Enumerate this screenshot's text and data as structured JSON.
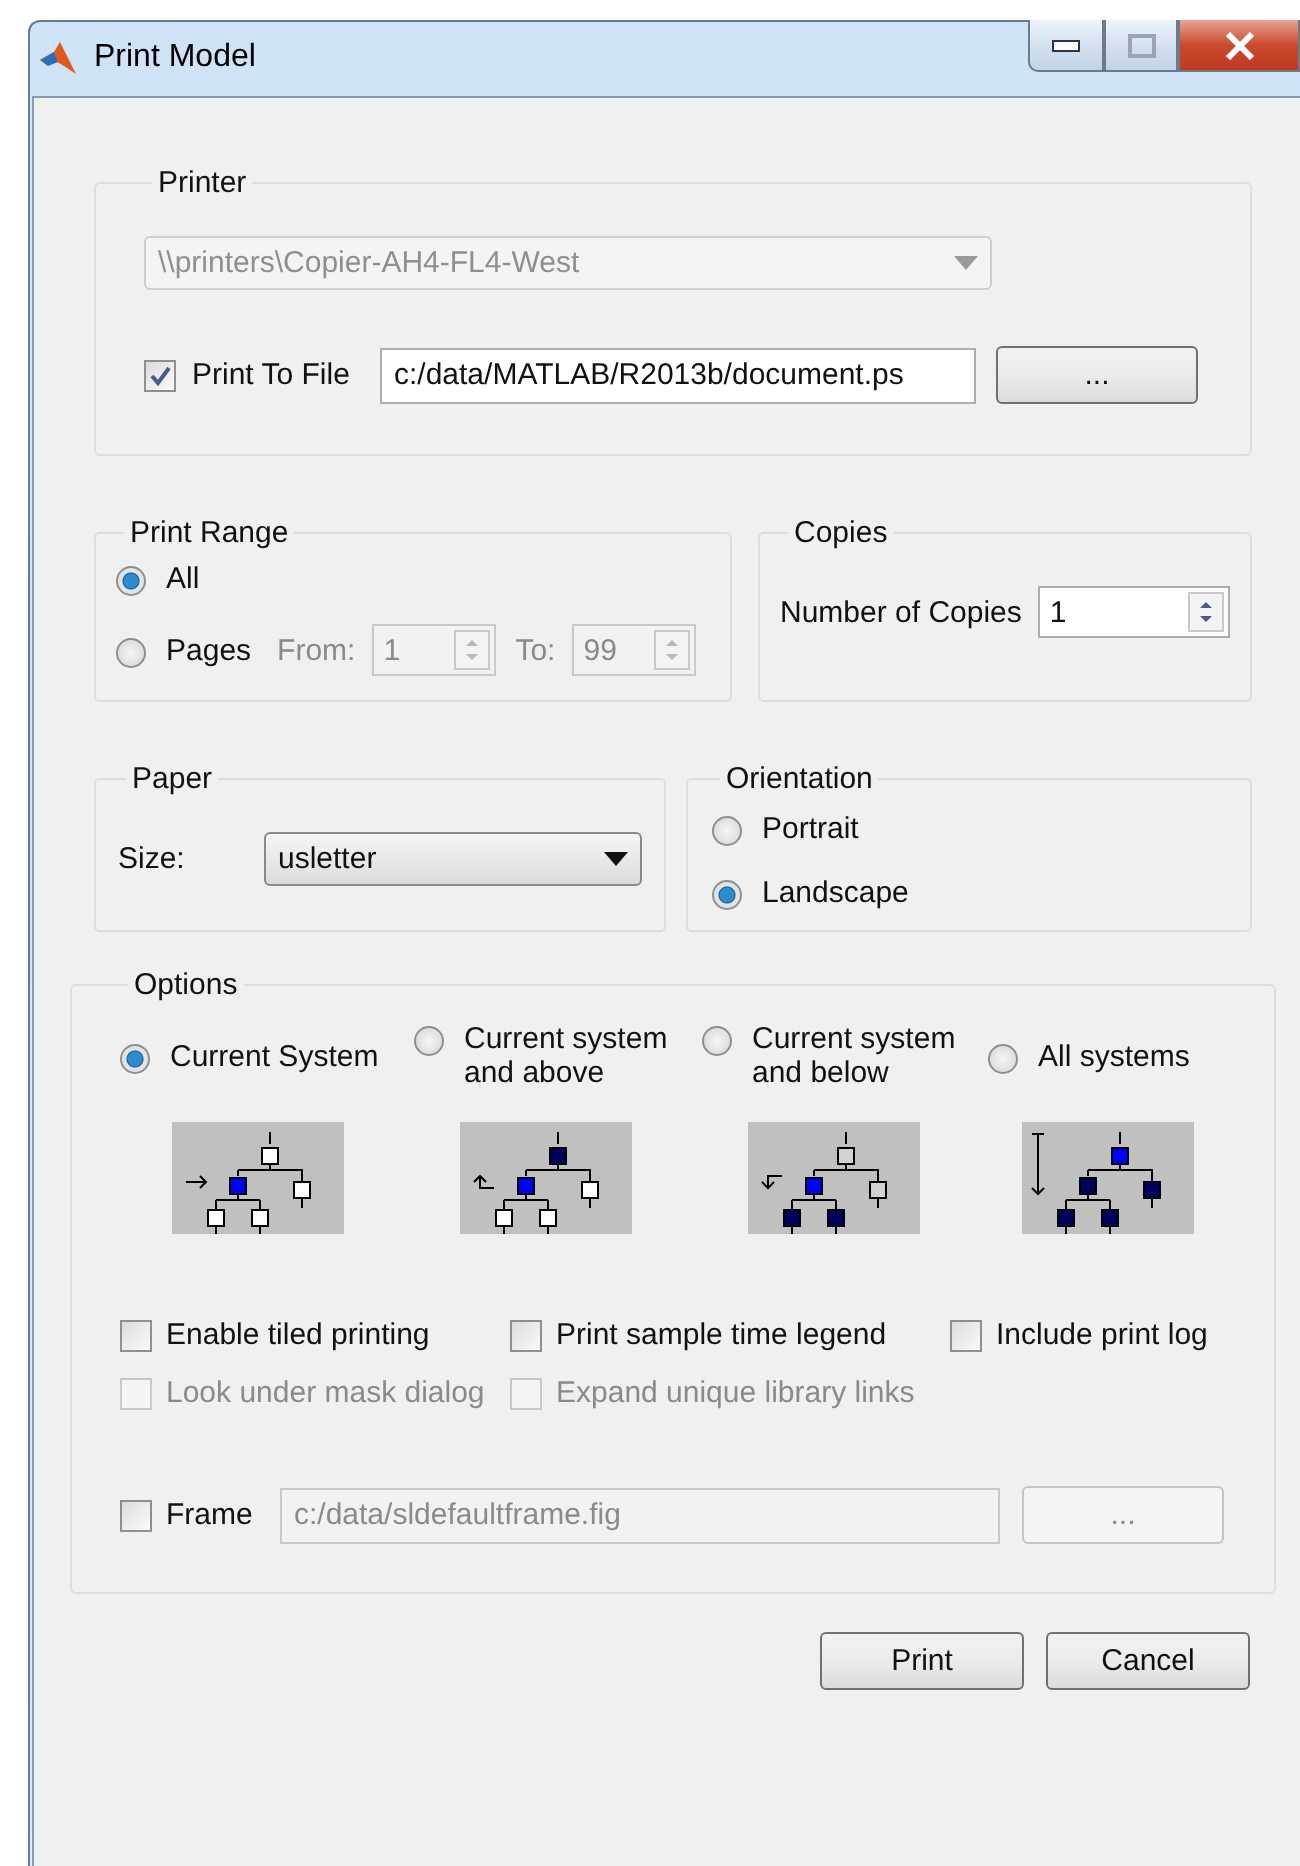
{
  "window": {
    "title": "Print Model"
  },
  "printer": {
    "title": "Printer",
    "device": {
      "value": "\\\\printers\\Copier-AH4-FL4-West",
      "disabled": true
    },
    "print_to_file": {
      "label": "Print To File",
      "checked": true
    },
    "file_path": "c:/data/MATLAB/R2013b/document.ps",
    "browse_label": "..."
  },
  "print_range": {
    "title": "Print Range",
    "options": [
      {
        "label": "All",
        "selected": true
      },
      {
        "label": "Pages",
        "selected": false
      }
    ],
    "from_label": "From:",
    "from_value": "1",
    "to_label": "To:",
    "to_value": "99",
    "disabled": true
  },
  "copies": {
    "title": "Copies",
    "label": "Number of Copies",
    "value": "1"
  },
  "paper": {
    "title": "Paper",
    "size_label": "Size:",
    "size_value": "usletter"
  },
  "orientation": {
    "title": "Orientation",
    "options": [
      {
        "label": "Portrait",
        "selected": false
      },
      {
        "label": "Landscape",
        "selected": true
      }
    ]
  },
  "options": {
    "title": "Options",
    "scope": [
      {
        "label": "Current System",
        "selected": true,
        "kind": "current"
      },
      {
        "label": "Current system and above",
        "selected": false,
        "kind": "above"
      },
      {
        "label": "Current system and below",
        "selected": false,
        "kind": "below"
      },
      {
        "label": "All systems",
        "selected": false,
        "kind": "all"
      }
    ],
    "checkboxes": [
      {
        "label": "Enable tiled printing",
        "checked": false,
        "disabled": false
      },
      {
        "label": "Print sample time legend",
        "checked": false,
        "disabled": false
      },
      {
        "label": "Include print log",
        "checked": false,
        "disabled": false
      },
      {
        "label": "Look under mask dialog",
        "checked": false,
        "disabled": true
      },
      {
        "label": "Expand unique library links",
        "checked": false,
        "disabled": true
      }
    ],
    "frame": {
      "label": "Frame",
      "checked": false,
      "path": "c:/data/sldefaultframe.fig",
      "browse_label": "...",
      "disabled": true
    }
  },
  "buttons": [
    "Print",
    "Cancel"
  ]
}
